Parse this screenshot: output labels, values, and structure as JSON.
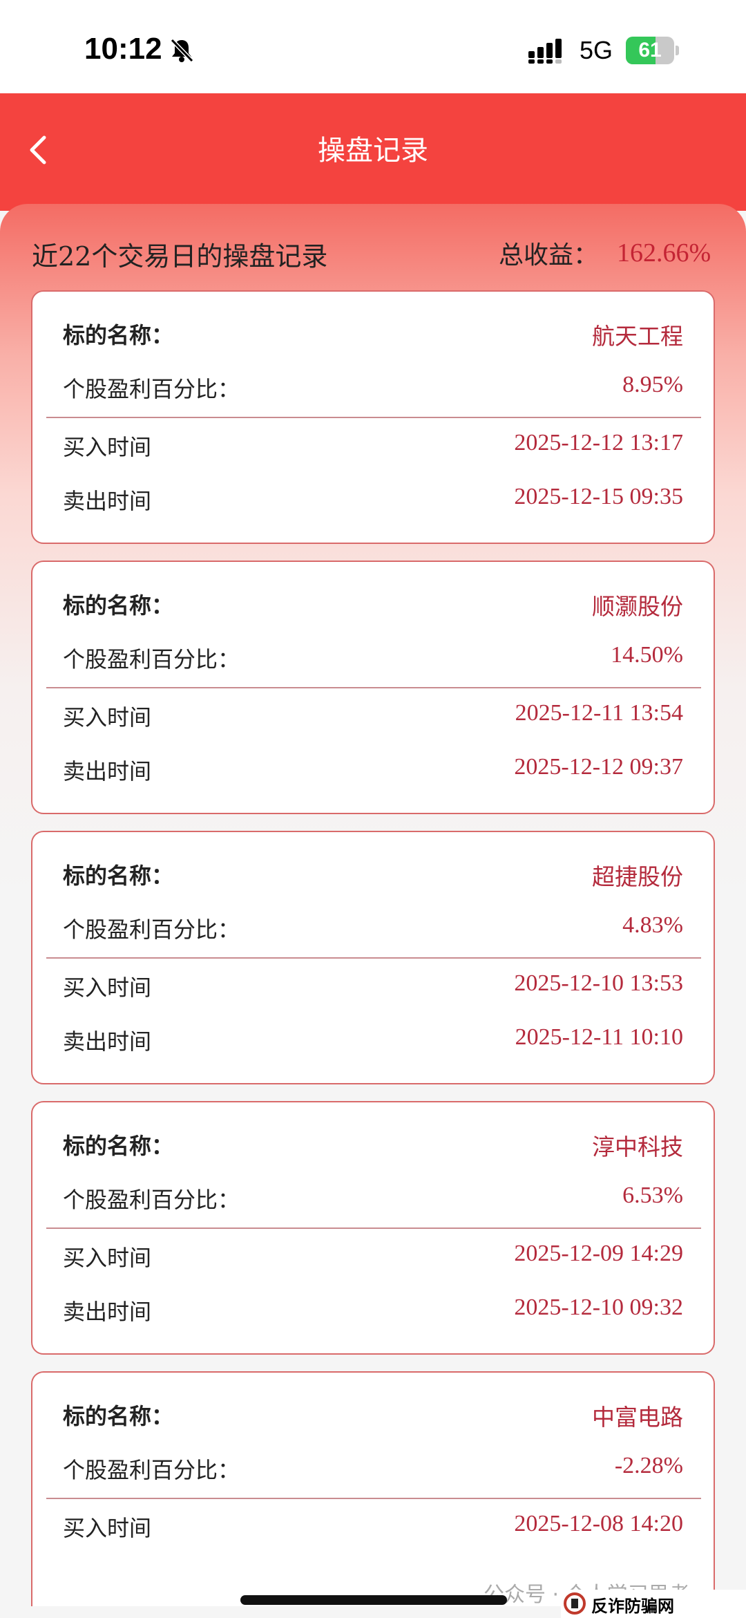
{
  "status_bar": {
    "time": "10:12",
    "network": "5G",
    "battery": "61",
    "battery_level": 0.61,
    "icons": [
      "bell-slash-icon",
      "signal-icon",
      "battery-charging-icon"
    ]
  },
  "header": {
    "title": "操盘记录",
    "back_icon": "chevron-left-icon"
  },
  "summary": {
    "left_text": "近22个交易日的操盘记录",
    "total_label": "总收益：",
    "total_value": "162.66%"
  },
  "labels": {
    "name": "标的名称：",
    "pct": "个股盈利百分比：",
    "buy": "买入时间",
    "sell": "卖出时间"
  },
  "records": [
    {
      "name": "航天工程",
      "pct": "8.95%",
      "buy": "2025-12-12 13:17",
      "sell": "2025-12-15 09:35"
    },
    {
      "name": "顺灏股份",
      "pct": "14.50%",
      "buy": "2025-12-11 13:54",
      "sell": "2025-12-12 09:37"
    },
    {
      "name": "超捷股份",
      "pct": "4.83%",
      "buy": "2025-12-10 13:53",
      "sell": "2025-12-11 10:10"
    },
    {
      "name": "淳中科技",
      "pct": "6.53%",
      "buy": "2025-12-09 14:29",
      "sell": "2025-12-10 09:32"
    },
    {
      "name": "中富电路",
      "pct": "-2.28%",
      "buy": "2025-12-08 14:20",
      "sell": ""
    }
  ],
  "watermark": "公众号 · 个人学习思考",
  "site_logo": "反诈防骗网 paodu.cc",
  "colors": {
    "header_red": "#f4433f",
    "value_red": "#b42a3c",
    "card_border": "#d96a6a"
  }
}
